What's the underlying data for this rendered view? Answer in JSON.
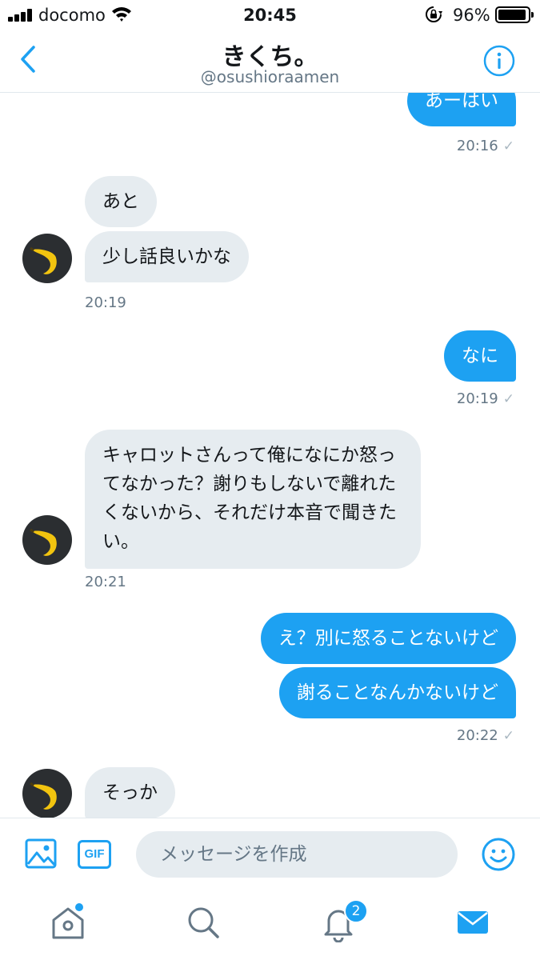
{
  "status_bar": {
    "carrier": "docomo",
    "time": "20:45",
    "battery": "96%",
    "battery_level": 0.96
  },
  "header": {
    "title": "きくち。",
    "handle": "@osushioraamen"
  },
  "messages": [
    {
      "from": "me",
      "text": "あーはい"
    },
    {
      "from": "me",
      "time": "20:16"
    },
    {
      "from": "them",
      "text": "あと"
    },
    {
      "from": "them",
      "text": "少し話良いかな"
    },
    {
      "from": "them",
      "time": "20:19"
    },
    {
      "from": "me",
      "text": "なに"
    },
    {
      "from": "me",
      "time": "20:19"
    },
    {
      "from": "them",
      "text": "キャロットさんって俺になにか怒ってなかった？謝りもしないで離れたくないから、それだけ本音で聞きたい。"
    },
    {
      "from": "them",
      "time": "20:21"
    },
    {
      "from": "me",
      "text": "え？別に怒ることないけど"
    },
    {
      "from": "me",
      "text": "謝ることなんかないけど"
    },
    {
      "from": "me",
      "time": "20:22"
    },
    {
      "from": "them",
      "text": "そっか"
    }
  ],
  "read_mark": "✓",
  "composer": {
    "placeholder": "メッセージを作成",
    "gif_label": "GIF"
  },
  "tab_bar": {
    "items": [
      {
        "name": "home",
        "icon": "home-icon",
        "has_dot": true
      },
      {
        "name": "search",
        "icon": "search-icon"
      },
      {
        "name": "notifications",
        "icon": "bell-icon",
        "badge": "2"
      },
      {
        "name": "messages",
        "icon": "mail-icon",
        "active": true
      }
    ]
  },
  "colors": {
    "accent": "#1da1f2",
    "incoming_bubble": "#e6ecf0",
    "muted_text": "#657786"
  }
}
